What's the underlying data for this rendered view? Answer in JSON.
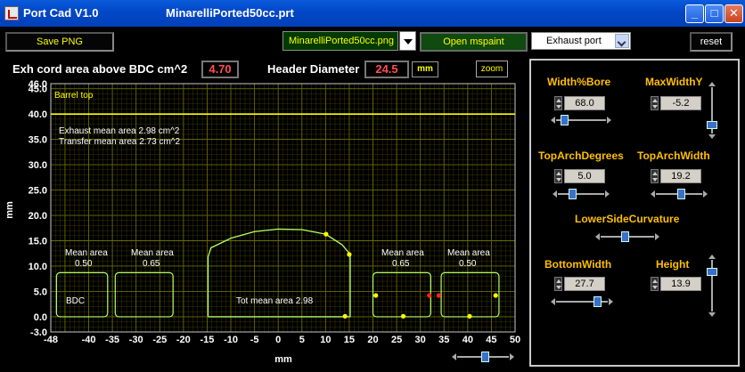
{
  "window": {
    "app_title": "Port Cad  V1.0",
    "doc_title": "MinarelliPorted50cc.prt",
    "minimize": "_",
    "maximize": "□",
    "close": "✕"
  },
  "toolbar": {
    "save_png": "Save PNG",
    "png_filename": "MinarelliPorted50cc.png",
    "open_mspaint": "Open mspaint",
    "port_select": "Exhaust port",
    "reset": "reset"
  },
  "header": {
    "exh_label": "Exh cord area above BDC  cm^2",
    "exh_value": "4.70",
    "diameter_label": "Header Diameter",
    "diameter_value": "24.5",
    "diameter_unit": "mm",
    "zoom": "zoom"
  },
  "plot": {
    "annotations": {
      "barrel_top": "Barrel top",
      "exhaust_mean": "Exhaust mean area  2.98 cm^2",
      "transfer_mean": "Transfer mean area 2.73 cm^2",
      "bdc": "BDC",
      "tot_mean": "Tot mean area 2.98",
      "mean_area": "Mean area",
      "v050": "0.50",
      "v065": "0.65"
    },
    "colors": {
      "background": "#000000",
      "grid": "#6b6b00",
      "outline": "#b4ff64",
      "barrel": "#ffff00",
      "point_yellow": "#ffff00",
      "point_red": "#ff2020"
    }
  },
  "chart_data": {
    "type": "line",
    "xlabel": "mm",
    "ylabel": "mm",
    "xlim": [
      -48,
      50
    ],
    "ylim": [
      -3,
      46
    ],
    "x_ticks": [
      "-48",
      "-40",
      "-35",
      "-30",
      "-25",
      "-20",
      "-15",
      "-10",
      "-5",
      "0",
      "5",
      "10",
      "15",
      "20",
      "25",
      "30",
      "35",
      "40",
      "45",
      "50"
    ],
    "y_ticks": [
      "46.0",
      "45.0",
      "40.0",
      "35.0",
      "30.0",
      "25.0",
      "20.0",
      "15.0",
      "10.0",
      "5.0",
      "0.0",
      "-3.0"
    ],
    "barrel_top_y": 40,
    "series": [
      {
        "kind": "port",
        "points": [
          [
            -14.8,
            0
          ],
          [
            -14.8,
            11.8
          ],
          [
            -14.2,
            13.6
          ],
          [
            -10,
            15.5
          ],
          [
            -5,
            16.8
          ],
          [
            0,
            17.3
          ],
          [
            5,
            17.2
          ],
          [
            10,
            16.3
          ],
          [
            13.5,
            14.2
          ],
          [
            15.2,
            12.3
          ],
          [
            15.2,
            0
          ],
          [
            -14.8,
            0
          ]
        ]
      },
      {
        "kind": "transfer",
        "points": [
          [
            -46.8,
            0
          ],
          [
            -36,
            0
          ],
          [
            -36,
            8.7
          ],
          [
            -46.8,
            8.7
          ],
          [
            -46.8,
            0
          ]
        ]
      },
      {
        "kind": "transfer",
        "points": [
          [
            -34.4,
            0
          ],
          [
            -22.2,
            0
          ],
          [
            -22.2,
            8.7
          ],
          [
            -34.4,
            8.7
          ],
          [
            -34.4,
            0
          ]
        ]
      },
      {
        "kind": "transfer",
        "points": [
          [
            20,
            0
          ],
          [
            32.2,
            0
          ],
          [
            32.2,
            8.7
          ],
          [
            20,
            8.7
          ],
          [
            20,
            0
          ]
        ]
      },
      {
        "kind": "transfer",
        "points": [
          [
            34.4,
            0
          ],
          [
            46.6,
            0
          ],
          [
            46.6,
            8.7
          ],
          [
            34.4,
            8.7
          ],
          [
            34.4,
            0
          ]
        ]
      }
    ],
    "markers": [
      {
        "x": 10.1,
        "y": 16.3,
        "color": "yellow"
      },
      {
        "x": 15.0,
        "y": 12.3,
        "color": "yellow"
      },
      {
        "x": 14.1,
        "y": 0.1,
        "color": "yellow"
      },
      {
        "x": 20.6,
        "y": 4.2,
        "color": "yellow"
      },
      {
        "x": 26.4,
        "y": 0.1,
        "color": "yellow"
      },
      {
        "x": 31.9,
        "y": 4.2,
        "color": "red"
      },
      {
        "x": 33.9,
        "y": 4.2,
        "color": "red"
      },
      {
        "x": 40.4,
        "y": 0.1,
        "color": "yellow"
      },
      {
        "x": 45.9,
        "y": 4.2,
        "color": "yellow"
      }
    ]
  },
  "controls": {
    "width_bore": {
      "label": "Width%Bore",
      "value": "68.0"
    },
    "max_width_y": {
      "label": "MaxWidthY",
      "value": "-5.2"
    },
    "top_arch_degrees": {
      "label": "TopArchDegrees",
      "value": "5.0"
    },
    "top_arch_width": {
      "label": "TopArchWidth",
      "value": "19.2"
    },
    "lower_side_curvature": {
      "label": "LowerSideCurvature"
    },
    "bottom_width": {
      "label": "BottomWidth",
      "value": "27.7"
    },
    "height": {
      "label": "Height",
      "value": "13.9"
    },
    "slider_levels": {
      "width_bore": 0.1,
      "max_width_y": 0.12,
      "top_arch_degrees": 0.28,
      "top_arch_width": 0.55,
      "lower_side_curvature": 0.45,
      "bottom_width": 0.85,
      "height": 0.82,
      "plot_scroll": 0.55
    }
  }
}
